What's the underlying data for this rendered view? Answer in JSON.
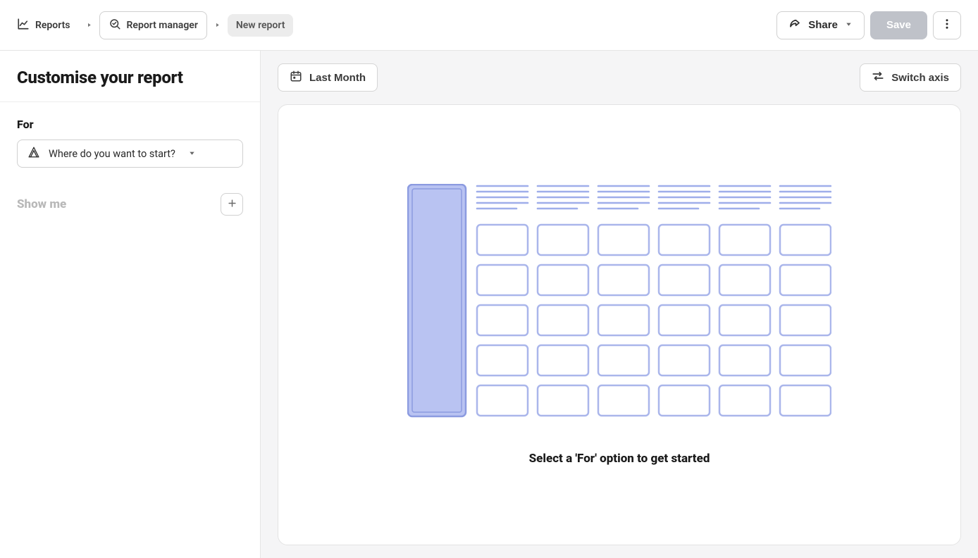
{
  "breadcrumb": {
    "reports": "Reports",
    "manager": "Report manager",
    "new": "New report"
  },
  "actions": {
    "share": "Share",
    "save": "Save"
  },
  "sidebar": {
    "title": "Customise your report",
    "for_label": "For",
    "for_placeholder": "Where do you want to start?",
    "show_me_label": "Show me"
  },
  "main": {
    "date_range": "Last Month",
    "switch_axis": "Switch axis",
    "empty_caption": "Select a 'For' option to get started"
  },
  "colors": {
    "placeholder_stroke": "#aab6eb",
    "placeholder_fill": "#b9c3f2",
    "placeholder_line": "#9faeea"
  }
}
